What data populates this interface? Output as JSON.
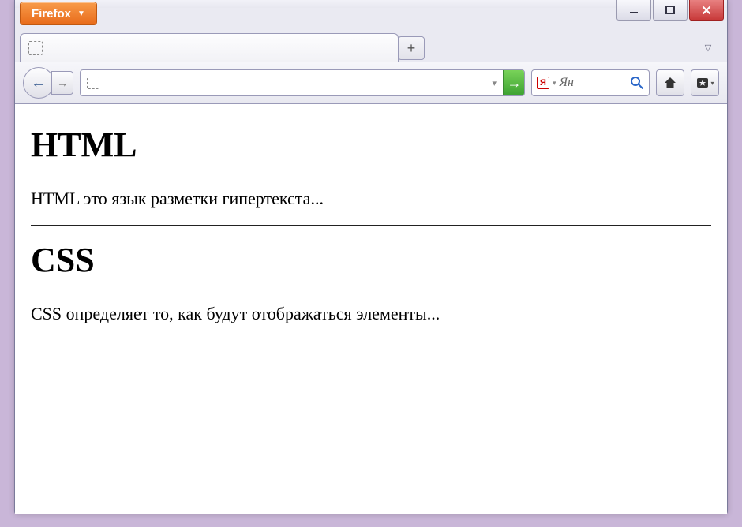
{
  "browser": {
    "app_button_label": "Firefox",
    "window_controls": {
      "minimize": "–",
      "maximize": "□",
      "close": "X"
    },
    "new_tab_label": "+",
    "nav": {
      "back": "←",
      "forward": "→",
      "go": "→"
    },
    "url_value": "",
    "search": {
      "engine_letter": "Я",
      "placeholder": "Ян"
    }
  },
  "page": {
    "heading1": "HTML",
    "paragraph1": "HTML это язык разметки гипертекста...",
    "heading2": "CSS",
    "paragraph2": "CSS определяет то, как будут отображаться элементы..."
  }
}
